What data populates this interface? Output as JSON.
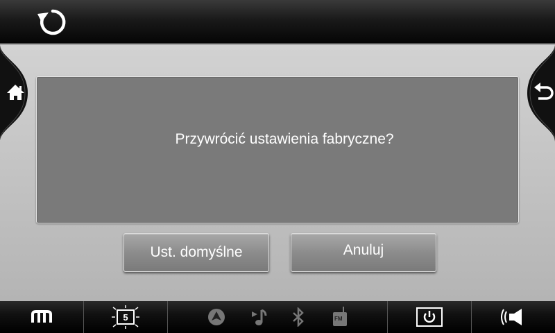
{
  "dialog": {
    "message": "Przywrócić ustawienia fabryczne?"
  },
  "buttons": {
    "default_label": "Ust. domyślne",
    "cancel_label": "Anuluj"
  },
  "bottombar": {
    "display_badge": "5",
    "radio_badge": "FM"
  },
  "icons": {
    "top_left": "refresh-icon",
    "side_left": "home-icon",
    "side_right": "back-icon",
    "bottom": [
      "menu-icon",
      "display-brightness-icon",
      "navigation-icon",
      "music-icon",
      "bluetooth-icon",
      "radio-icon",
      "power-icon",
      "volume-icon"
    ]
  },
  "colors": {
    "dialog_bg": "#7a7a7a",
    "text": "#ffffff"
  }
}
